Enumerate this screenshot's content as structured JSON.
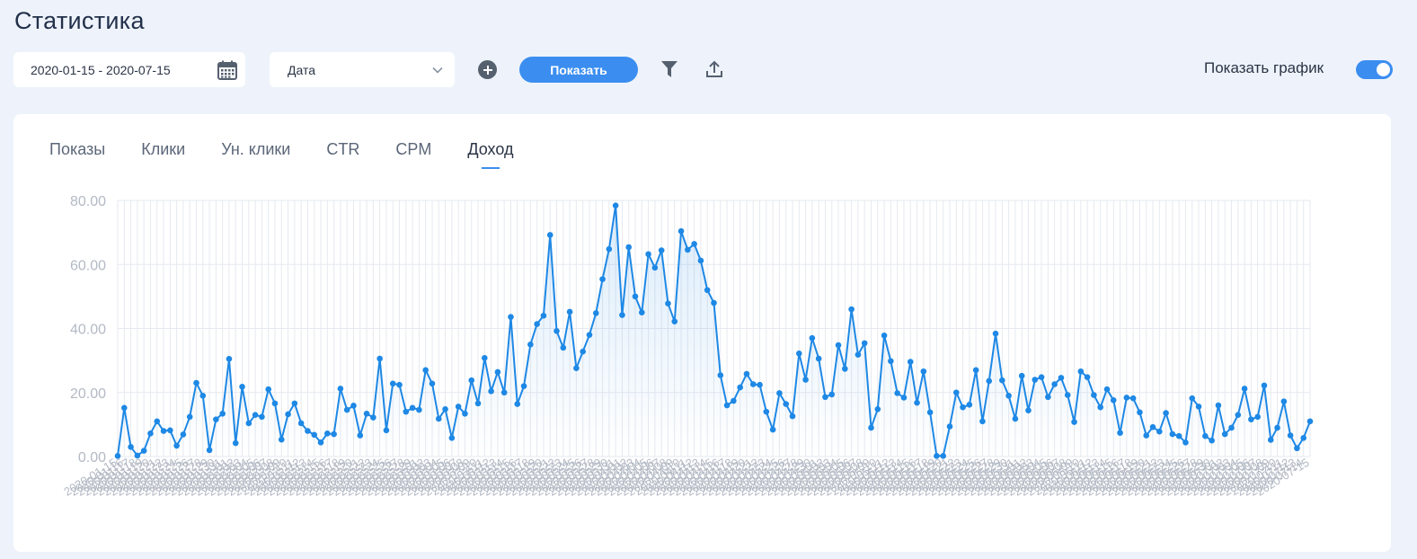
{
  "page": {
    "title": "Статистика"
  },
  "toolbar": {
    "date_range": "2020-01-15 - 2020-07-15",
    "group_by": "Дата",
    "show_button": "Показать",
    "show_chart_label": "Показать график",
    "show_chart_enabled": true
  },
  "tabs": [
    {
      "label": "Показы",
      "active": false
    },
    {
      "label": "Клики",
      "active": false
    },
    {
      "label": "Ун. клики",
      "active": false
    },
    {
      "label": "CTR",
      "active": false
    },
    {
      "label": "CPM",
      "active": false
    },
    {
      "label": "Доход",
      "active": true
    }
  ],
  "colors": {
    "accent": "#3b8ef0",
    "line": "#1e88e5",
    "point": "#1e88e5",
    "grid": "#e6e9ef",
    "axis_text": "#b3b9c4"
  },
  "chart_data": {
    "type": "line",
    "title": "",
    "xlabel": "",
    "ylabel": "",
    "ylim": [
      0,
      80
    ],
    "y_ticks": [
      "0.00",
      "20.00",
      "40.00",
      "60.00",
      "80.00"
    ],
    "grid": true,
    "x_start_date": "2020-01-15",
    "x_end_date": "2020-07-15",
    "series": [
      {
        "name": "Доход",
        "values": [
          0.2,
          15.2,
          3.0,
          0.3,
          1.8,
          7.2,
          11.0,
          8.0,
          8.2,
          3.4,
          6.9,
          12.4,
          23.0,
          19.0,
          2.0,
          11.6,
          13.4,
          30.5,
          4.2,
          21.8,
          10.4,
          13.0,
          12.4,
          21.0,
          16.6,
          5.3,
          13.2,
          16.6,
          10.4,
          8.0,
          6.8,
          4.4,
          7.2,
          7.0,
          21.2,
          14.6,
          15.9,
          6.6,
          13.4,
          12.2,
          30.6,
          8.2,
          22.8,
          22.4,
          14.0,
          15.2,
          14.6,
          27.0,
          22.8,
          11.8,
          14.8,
          5.8,
          15.6,
          13.4,
          23.8,
          16.6,
          30.8,
          20.4,
          26.4,
          20.0,
          43.6,
          16.4,
          22.0,
          35.0,
          41.4,
          44.0,
          69.2,
          39.2,
          34.0,
          45.2,
          27.6,
          32.8,
          38.0,
          44.8,
          55.4,
          64.8,
          78.4,
          44.2,
          65.4,
          50.0,
          45.0,
          63.2,
          59.0,
          64.4,
          47.8,
          42.2,
          70.4,
          64.6,
          66.4,
          61.2,
          52.0,
          48.0,
          25.4,
          16.0,
          17.4,
          21.6,
          25.8,
          22.6,
          22.4,
          14.0,
          8.4,
          19.8,
          16.4,
          12.6,
          32.2,
          24.0,
          37.0,
          30.6,
          18.6,
          19.4,
          34.8,
          27.4,
          46.0,
          31.8,
          35.4,
          9.0,
          14.8,
          37.8,
          29.8,
          19.8,
          18.4,
          29.6,
          16.8,
          26.6,
          13.8,
          0.2,
          0.2,
          9.4,
          20.0,
          15.4,
          16.2,
          27.0,
          11.0,
          23.6,
          38.4,
          23.8,
          19.0,
          11.8,
          25.2,
          14.4,
          24.0,
          24.8,
          18.6,
          22.6,
          24.6,
          19.2,
          10.8,
          26.6,
          24.8,
          19.2,
          15.4,
          21.0,
          17.6,
          7.4,
          18.4,
          18.2,
          13.8,
          6.6,
          9.2,
          7.8,
          13.6,
          7.0,
          6.4,
          4.4,
          18.2,
          15.6,
          6.4,
          5.0,
          16.0,
          7.0,
          9.0,
          13.0,
          21.2,
          11.6,
          12.4,
          22.2,
          5.2,
          9.0,
          17.2,
          6.6,
          2.6,
          5.8,
          11.0
        ]
      }
    ]
  }
}
